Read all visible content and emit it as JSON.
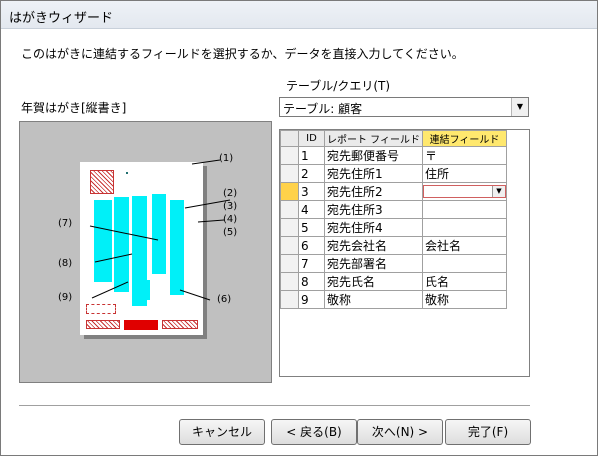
{
  "window": {
    "title": "はがきウィザード"
  },
  "instruction": "このはがきに連結するフィールドを選択するか、データを直接入力してください。",
  "table_label": "テーブル/クエリ(T)",
  "table_combo": {
    "value": "テーブル: 顧客"
  },
  "layout_label": "年賀はがき[縦書き]",
  "callouts": [
    "(1)",
    "(2)",
    "(3)",
    "(4)",
    "(5)",
    "(6)",
    "(7)",
    "(8)",
    "(9)"
  ],
  "grid": {
    "headers": [
      "ID",
      "レポート フィールド",
      "連結フィールド"
    ],
    "rows": [
      {
        "id": "1",
        "report": "宛先郵便番号",
        "link": "〒"
      },
      {
        "id": "2",
        "report": "宛先住所1",
        "link": "住所"
      },
      {
        "id": "3",
        "report": "宛先住所2",
        "link": ""
      },
      {
        "id": "4",
        "report": "宛先住所3",
        "link": ""
      },
      {
        "id": "5",
        "report": "宛先住所4",
        "link": ""
      },
      {
        "id": "6",
        "report": "宛先会社名",
        "link": "会社名"
      },
      {
        "id": "7",
        "report": "宛先部署名",
        "link": ""
      },
      {
        "id": "8",
        "report": "宛先氏名",
        "link": "氏名"
      },
      {
        "id": "9",
        "report": "敬称",
        "link": "敬称"
      }
    ]
  },
  "buttons": {
    "cancel": "キャンセル",
    "back": "< 戻る(B)",
    "next": "次へ(N) >",
    "finish": "完了(F)"
  },
  "colors": {
    "accent_cyan": "#00f0f8",
    "stamp_red": "#c83232",
    "current_row": "#ffd24a",
    "link_header": "#ffe86e"
  }
}
